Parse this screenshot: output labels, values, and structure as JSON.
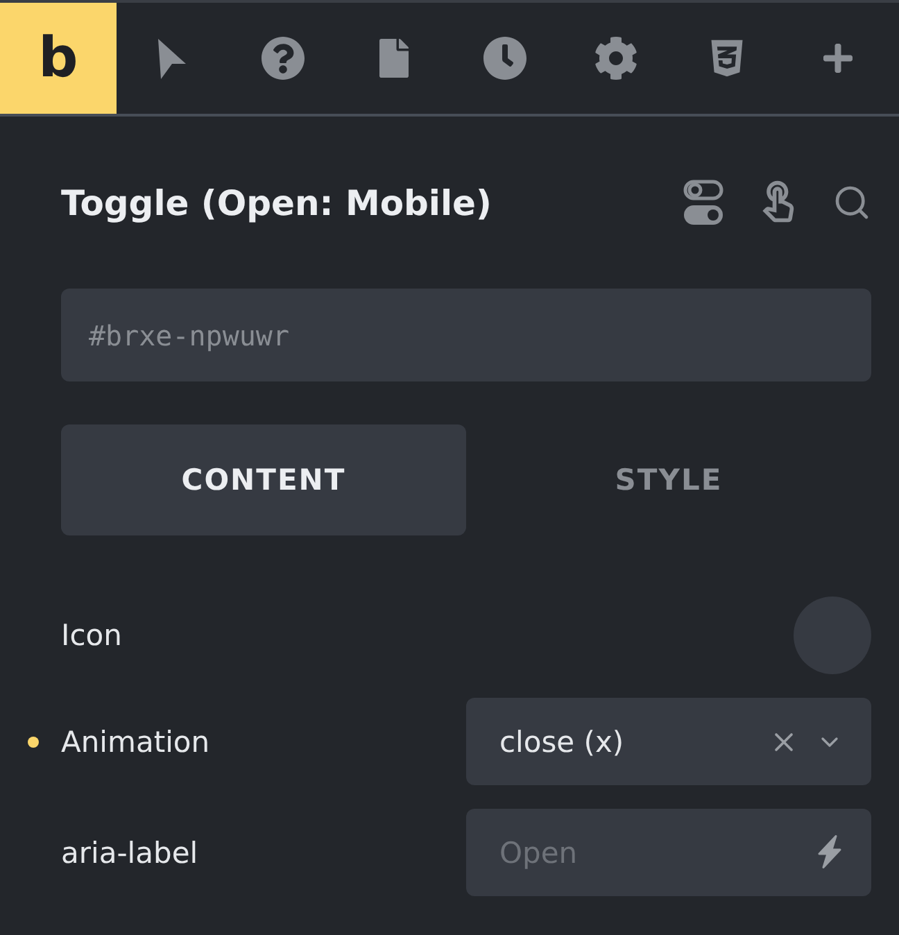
{
  "toolbar": {
    "logo": "b"
  },
  "panel": {
    "title": "Toggle (Open: Mobile)",
    "id_field": {
      "placeholder": "#brxe-npwuwr"
    },
    "tabs": [
      {
        "label": "CONTENT",
        "selected": true
      },
      {
        "label": "STYLE",
        "selected": false
      }
    ],
    "controls": [
      {
        "kind": "icon",
        "label": "Icon",
        "modified": false
      },
      {
        "kind": "select",
        "label": "Animation",
        "value": "close (x)",
        "modified": true
      },
      {
        "kind": "text",
        "label": "aria-label",
        "placeholder": "Open",
        "modified": false
      }
    ]
  }
}
